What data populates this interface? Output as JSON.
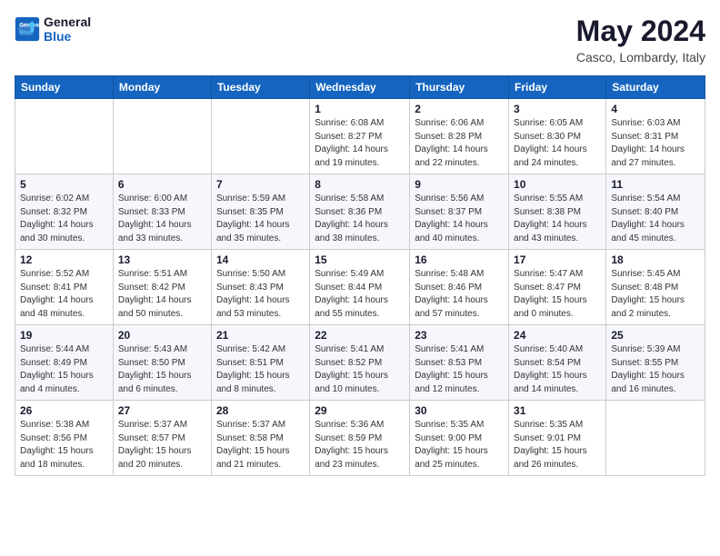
{
  "logo": {
    "line1": "General",
    "line2": "Blue"
  },
  "header": {
    "month": "May 2024",
    "location": "Casco, Lombardy, Italy"
  },
  "weekdays": [
    "Sunday",
    "Monday",
    "Tuesday",
    "Wednesday",
    "Thursday",
    "Friday",
    "Saturday"
  ],
  "weeks": [
    [
      {
        "day": "",
        "info": ""
      },
      {
        "day": "",
        "info": ""
      },
      {
        "day": "",
        "info": ""
      },
      {
        "day": "1",
        "info": "Sunrise: 6:08 AM\nSunset: 8:27 PM\nDaylight: 14 hours\nand 19 minutes."
      },
      {
        "day": "2",
        "info": "Sunrise: 6:06 AM\nSunset: 8:28 PM\nDaylight: 14 hours\nand 22 minutes."
      },
      {
        "day": "3",
        "info": "Sunrise: 6:05 AM\nSunset: 8:30 PM\nDaylight: 14 hours\nand 24 minutes."
      },
      {
        "day": "4",
        "info": "Sunrise: 6:03 AM\nSunset: 8:31 PM\nDaylight: 14 hours\nand 27 minutes."
      }
    ],
    [
      {
        "day": "5",
        "info": "Sunrise: 6:02 AM\nSunset: 8:32 PM\nDaylight: 14 hours\nand 30 minutes."
      },
      {
        "day": "6",
        "info": "Sunrise: 6:00 AM\nSunset: 8:33 PM\nDaylight: 14 hours\nand 33 minutes."
      },
      {
        "day": "7",
        "info": "Sunrise: 5:59 AM\nSunset: 8:35 PM\nDaylight: 14 hours\nand 35 minutes."
      },
      {
        "day": "8",
        "info": "Sunrise: 5:58 AM\nSunset: 8:36 PM\nDaylight: 14 hours\nand 38 minutes."
      },
      {
        "day": "9",
        "info": "Sunrise: 5:56 AM\nSunset: 8:37 PM\nDaylight: 14 hours\nand 40 minutes."
      },
      {
        "day": "10",
        "info": "Sunrise: 5:55 AM\nSunset: 8:38 PM\nDaylight: 14 hours\nand 43 minutes."
      },
      {
        "day": "11",
        "info": "Sunrise: 5:54 AM\nSunset: 8:40 PM\nDaylight: 14 hours\nand 45 minutes."
      }
    ],
    [
      {
        "day": "12",
        "info": "Sunrise: 5:52 AM\nSunset: 8:41 PM\nDaylight: 14 hours\nand 48 minutes."
      },
      {
        "day": "13",
        "info": "Sunrise: 5:51 AM\nSunset: 8:42 PM\nDaylight: 14 hours\nand 50 minutes."
      },
      {
        "day": "14",
        "info": "Sunrise: 5:50 AM\nSunset: 8:43 PM\nDaylight: 14 hours\nand 53 minutes."
      },
      {
        "day": "15",
        "info": "Sunrise: 5:49 AM\nSunset: 8:44 PM\nDaylight: 14 hours\nand 55 minutes."
      },
      {
        "day": "16",
        "info": "Sunrise: 5:48 AM\nSunset: 8:46 PM\nDaylight: 14 hours\nand 57 minutes."
      },
      {
        "day": "17",
        "info": "Sunrise: 5:47 AM\nSunset: 8:47 PM\nDaylight: 15 hours\nand 0 minutes."
      },
      {
        "day": "18",
        "info": "Sunrise: 5:45 AM\nSunset: 8:48 PM\nDaylight: 15 hours\nand 2 minutes."
      }
    ],
    [
      {
        "day": "19",
        "info": "Sunrise: 5:44 AM\nSunset: 8:49 PM\nDaylight: 15 hours\nand 4 minutes."
      },
      {
        "day": "20",
        "info": "Sunrise: 5:43 AM\nSunset: 8:50 PM\nDaylight: 15 hours\nand 6 minutes."
      },
      {
        "day": "21",
        "info": "Sunrise: 5:42 AM\nSunset: 8:51 PM\nDaylight: 15 hours\nand 8 minutes."
      },
      {
        "day": "22",
        "info": "Sunrise: 5:41 AM\nSunset: 8:52 PM\nDaylight: 15 hours\nand 10 minutes."
      },
      {
        "day": "23",
        "info": "Sunrise: 5:41 AM\nSunset: 8:53 PM\nDaylight: 15 hours\nand 12 minutes."
      },
      {
        "day": "24",
        "info": "Sunrise: 5:40 AM\nSunset: 8:54 PM\nDaylight: 15 hours\nand 14 minutes."
      },
      {
        "day": "25",
        "info": "Sunrise: 5:39 AM\nSunset: 8:55 PM\nDaylight: 15 hours\nand 16 minutes."
      }
    ],
    [
      {
        "day": "26",
        "info": "Sunrise: 5:38 AM\nSunset: 8:56 PM\nDaylight: 15 hours\nand 18 minutes."
      },
      {
        "day": "27",
        "info": "Sunrise: 5:37 AM\nSunset: 8:57 PM\nDaylight: 15 hours\nand 20 minutes."
      },
      {
        "day": "28",
        "info": "Sunrise: 5:37 AM\nSunset: 8:58 PM\nDaylight: 15 hours\nand 21 minutes."
      },
      {
        "day": "29",
        "info": "Sunrise: 5:36 AM\nSunset: 8:59 PM\nDaylight: 15 hours\nand 23 minutes."
      },
      {
        "day": "30",
        "info": "Sunrise: 5:35 AM\nSunset: 9:00 PM\nDaylight: 15 hours\nand 25 minutes."
      },
      {
        "day": "31",
        "info": "Sunrise: 5:35 AM\nSunset: 9:01 PM\nDaylight: 15 hours\nand 26 minutes."
      },
      {
        "day": "",
        "info": ""
      }
    ]
  ]
}
